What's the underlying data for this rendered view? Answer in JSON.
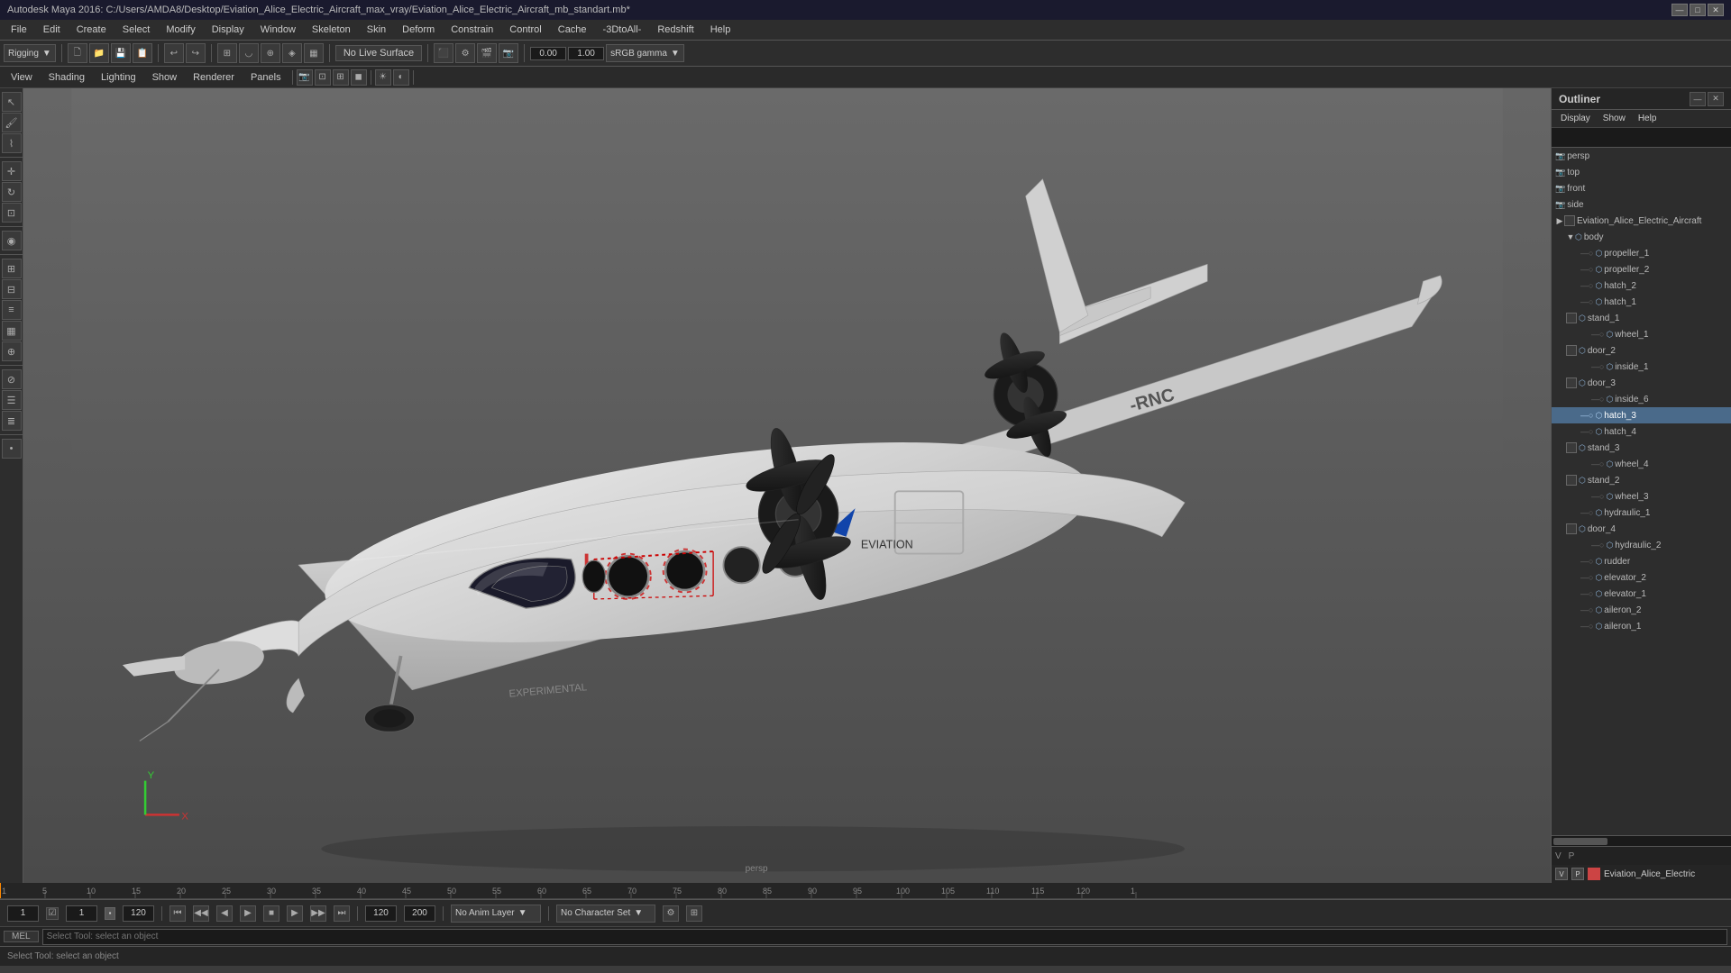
{
  "window": {
    "title": "Autodesk Maya 2016: C:/Users/AMDA8/Desktop/Eviation_Alice_Electric_Aircraft_max_vray/Eviation_Alice_Electric_Aircraft_mb_standart.mb*",
    "controls": [
      "—",
      "□",
      "✕"
    ]
  },
  "menubar": {
    "items": [
      "File",
      "Edit",
      "Create",
      "Select",
      "Modify",
      "Display",
      "Window",
      "Skeleton",
      "Skin",
      "Deform",
      "Constrain",
      "Control",
      "Cache",
      "-3DtoAll-",
      "Redshift",
      "Help"
    ]
  },
  "toolbar": {
    "mode_dropdown": "Rigging",
    "no_live_surface": "No Live Surface",
    "color_space": "sRGB gamma",
    "value1": "0.00",
    "value2": "1.00"
  },
  "view_menu": {
    "items": [
      "View",
      "Shading",
      "Lighting",
      "Show",
      "Renderer",
      "Panels"
    ]
  },
  "viewport": {
    "label": "persp",
    "background": "#5a5a5a"
  },
  "outliner": {
    "title": "Outliner",
    "menu_items": [
      "Display",
      "Show",
      "Help"
    ],
    "cameras": [
      {
        "name": "persp",
        "type": "cam"
      },
      {
        "name": "top",
        "type": "cam"
      },
      {
        "name": "front",
        "type": "cam"
      },
      {
        "name": "side",
        "type": "cam"
      }
    ],
    "root": "Eviation_Alice_Electric_Aircraft",
    "nodes": [
      {
        "name": "body",
        "depth": 1,
        "hasChildren": true
      },
      {
        "name": "propeller_1",
        "depth": 2,
        "hasChildren": false
      },
      {
        "name": "propeller_2",
        "depth": 2,
        "hasChildren": false
      },
      {
        "name": "hatch_2",
        "depth": 2,
        "hasChildren": false
      },
      {
        "name": "hatch_1",
        "depth": 2,
        "hasChildren": false
      },
      {
        "name": "stand_1",
        "depth": 2,
        "hasChildren": true
      },
      {
        "name": "wheel_1",
        "depth": 3,
        "hasChildren": false
      },
      {
        "name": "door_2",
        "depth": 2,
        "hasChildren": true
      },
      {
        "name": "inside_1",
        "depth": 3,
        "hasChildren": false
      },
      {
        "name": "door_3",
        "depth": 2,
        "hasChildren": true
      },
      {
        "name": "inside_6",
        "depth": 3,
        "hasChildren": false
      },
      {
        "name": "hatch_3",
        "depth": 2,
        "hasChildren": false,
        "selected": true
      },
      {
        "name": "hatch_4",
        "depth": 2,
        "hasChildren": false
      },
      {
        "name": "stand_3",
        "depth": 2,
        "hasChildren": true
      },
      {
        "name": "wheel_4",
        "depth": 3,
        "hasChildren": false
      },
      {
        "name": "stand_2",
        "depth": 2,
        "hasChildren": true
      },
      {
        "name": "wheel_3",
        "depth": 3,
        "hasChildren": false
      },
      {
        "name": "hydraulic_1",
        "depth": 2,
        "hasChildren": false
      },
      {
        "name": "door_4",
        "depth": 2,
        "hasChildren": true
      },
      {
        "name": "hydraulic_2",
        "depth": 3,
        "hasChildren": false
      },
      {
        "name": "rudder",
        "depth": 2,
        "hasChildren": false
      },
      {
        "name": "elevator_2",
        "depth": 2,
        "hasChildren": false
      },
      {
        "name": "elevator_1",
        "depth": 2,
        "hasChildren": false
      },
      {
        "name": "aileron_2",
        "depth": 2,
        "hasChildren": false
      },
      {
        "name": "aileron_1",
        "depth": 2,
        "hasChildren": false
      }
    ]
  },
  "layers": {
    "layer_name": "Eviation_Alice_Electric",
    "v_label": "V",
    "p_label": "P"
  },
  "timeline": {
    "marks": [
      1,
      5,
      10,
      15,
      20,
      25,
      30,
      35,
      40,
      45,
      50,
      55,
      60,
      65,
      70,
      75,
      80,
      85,
      90,
      95,
      100,
      105,
      110,
      115,
      120
    ],
    "start_frame": "1",
    "current_frame": "1",
    "end_frame": "120",
    "range_start": "1",
    "range_end": "120",
    "anim_layer": "No Anim Layer",
    "character_set": "No Character Set"
  },
  "playback": {
    "buttons": [
      "⏮",
      "⏭",
      "◄◄",
      "◄",
      "■",
      "►",
      "◄►",
      "►◄",
      "▶▶"
    ]
  },
  "mel": {
    "label": "MEL",
    "placeholder": "Select Tool: select an object"
  },
  "status_bar": {
    "message": "Select Tool: select an object"
  }
}
